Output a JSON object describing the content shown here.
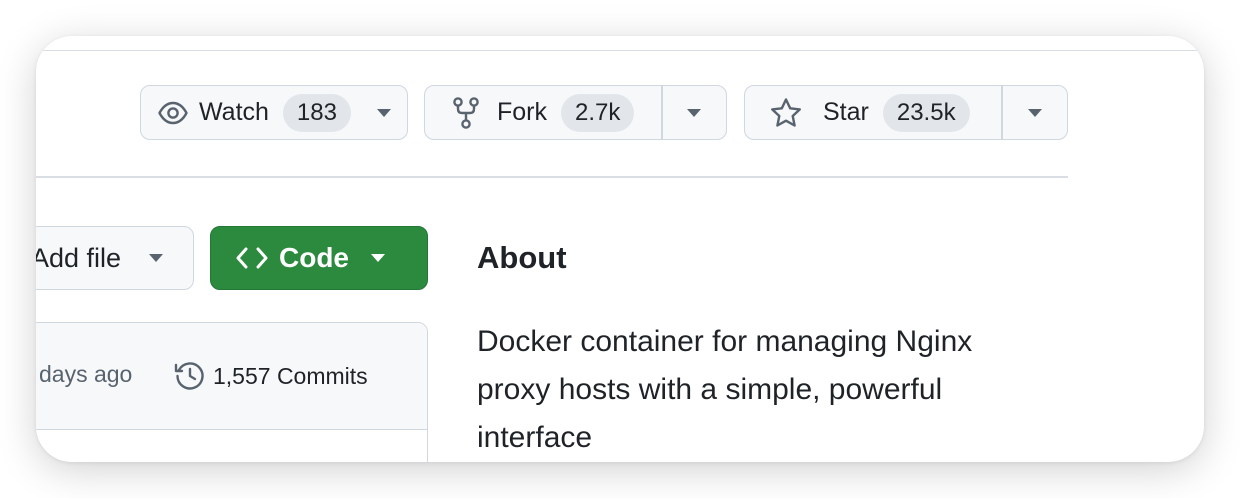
{
  "repo_actions": {
    "watch": {
      "label": "Watch",
      "count": "183"
    },
    "fork": {
      "label": "Fork",
      "count": "2.7k"
    },
    "star": {
      "label": "Star",
      "count": "23.5k"
    }
  },
  "toolbar": {
    "add_file_label": "Add file",
    "code_label": "Code"
  },
  "latest_commit": {
    "time_ago": "days ago",
    "commits_label": "1,557 Commits"
  },
  "about": {
    "title": "About",
    "description": "Docker container for managing Nginx proxy hosts with a simple, powerful interface"
  },
  "colors": {
    "code_button": "#2c8a3f",
    "button_bg": "#f6f8fa",
    "border": "#d0d7de"
  }
}
